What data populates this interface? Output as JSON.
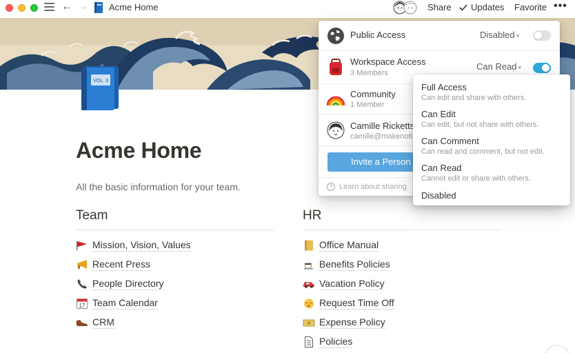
{
  "window": {
    "title": "Acme Home"
  },
  "topbar": {
    "share_label": "Share",
    "updates_label": "Updates",
    "favorite_label": "Favorite",
    "more_label": "•••",
    "back_icon": "←",
    "forward_icon": "→"
  },
  "page": {
    "title": "Acme Home",
    "description": "All the basic information for your team.",
    "icon": "blue-book-icon",
    "icon_text": "VOL. 3"
  },
  "team": {
    "heading": "Team",
    "items": [
      {
        "label": "Mission, Vision, Values",
        "icon": "red-flag-icon"
      },
      {
        "label": "Recent Press",
        "icon": "megaphone-icon"
      },
      {
        "label": "People Directory",
        "icon": "telephone-icon"
      },
      {
        "label": "Team Calendar",
        "icon": "calendar-icon",
        "icon_text": "17"
      },
      {
        "label": "CRM",
        "icon": "shoe-icon"
      }
    ]
  },
  "hr": {
    "heading": "HR",
    "items": [
      {
        "label": "Office Manual",
        "icon": "notebook-icon"
      },
      {
        "label": "Benefits Policies",
        "icon": "coffee-icon"
      },
      {
        "label": "Vacation Policy",
        "icon": "car-icon"
      },
      {
        "label": "Request Time Off",
        "icon": "sleepy-face-icon"
      },
      {
        "label": "Expense Policy",
        "icon": "money-icon"
      },
      {
        "label": "Policies",
        "icon": "document-icon"
      }
    ]
  },
  "share_popup": {
    "public": {
      "label": "Public Access",
      "value": "Disabled",
      "enabled": false
    },
    "workspace": {
      "label": "Workspace Access",
      "sub": "3 Members",
      "value": "Can Read",
      "enabled": true
    },
    "community": {
      "label": "Community",
      "sub": "1 Member"
    },
    "person": {
      "name": "Camille Ricketts",
      "email": "camille@makenoti"
    },
    "invite_label": "Invite a Person",
    "learn_label": "Learn about sharing",
    "learn_icon_text": "?"
  },
  "permission_menu": {
    "options": [
      {
        "title": "Full Access",
        "desc": "Can edit and share with others."
      },
      {
        "title": "Can Edit",
        "desc": "Can edit, but not share with others."
      },
      {
        "title": "Can Comment",
        "desc": "Can read and comment, but not edit."
      },
      {
        "title": "Can Read",
        "desc": "Cannot edit or share with others."
      },
      {
        "title": "Disabled",
        "desc": ""
      }
    ]
  },
  "colors": {
    "accent": "#2eaadc",
    "invite_button": "#5aa6de",
    "text": "#37352f",
    "muted": "#9b9a97"
  }
}
